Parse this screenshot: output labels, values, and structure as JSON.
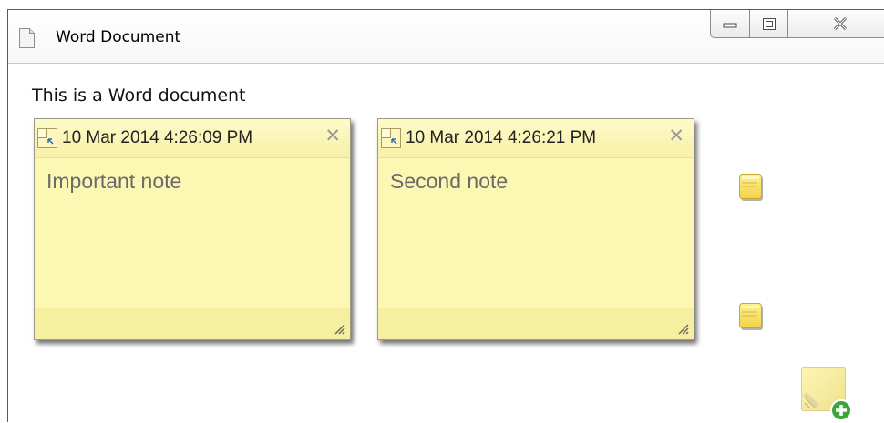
{
  "window": {
    "title": "Word Document",
    "doc_icon": "document-icon",
    "controls": {
      "minimize_icon": "minimize-icon",
      "maximize_icon": "maximize-icon",
      "close_icon": "close-icon"
    }
  },
  "document": {
    "text": "This is a Word document"
  },
  "notes": [
    {
      "date": "10 Mar 2014 4:26:09 PM",
      "body": "Important note",
      "close_glyph": "✕",
      "pin_icon": "pin-icon",
      "grip_icon": "resize-grip-icon"
    },
    {
      "date": "10 Mar 2014 4:26:21 PM",
      "body": "Second note",
      "close_glyph": "✕",
      "pin_icon": "pin-icon",
      "grip_icon": "resize-grip-icon"
    }
  ],
  "collapsed_notes": [
    {
      "icon": "collapsed-note-icon"
    },
    {
      "icon": "collapsed-note-icon"
    }
  ],
  "add_note": {
    "icon": "add-note-icon"
  },
  "colors": {
    "note_bg": "#fcf8b4",
    "note_header": "#f8f1a8",
    "note_text": "#6a6a6a",
    "add_badge": "#3aa63a"
  }
}
